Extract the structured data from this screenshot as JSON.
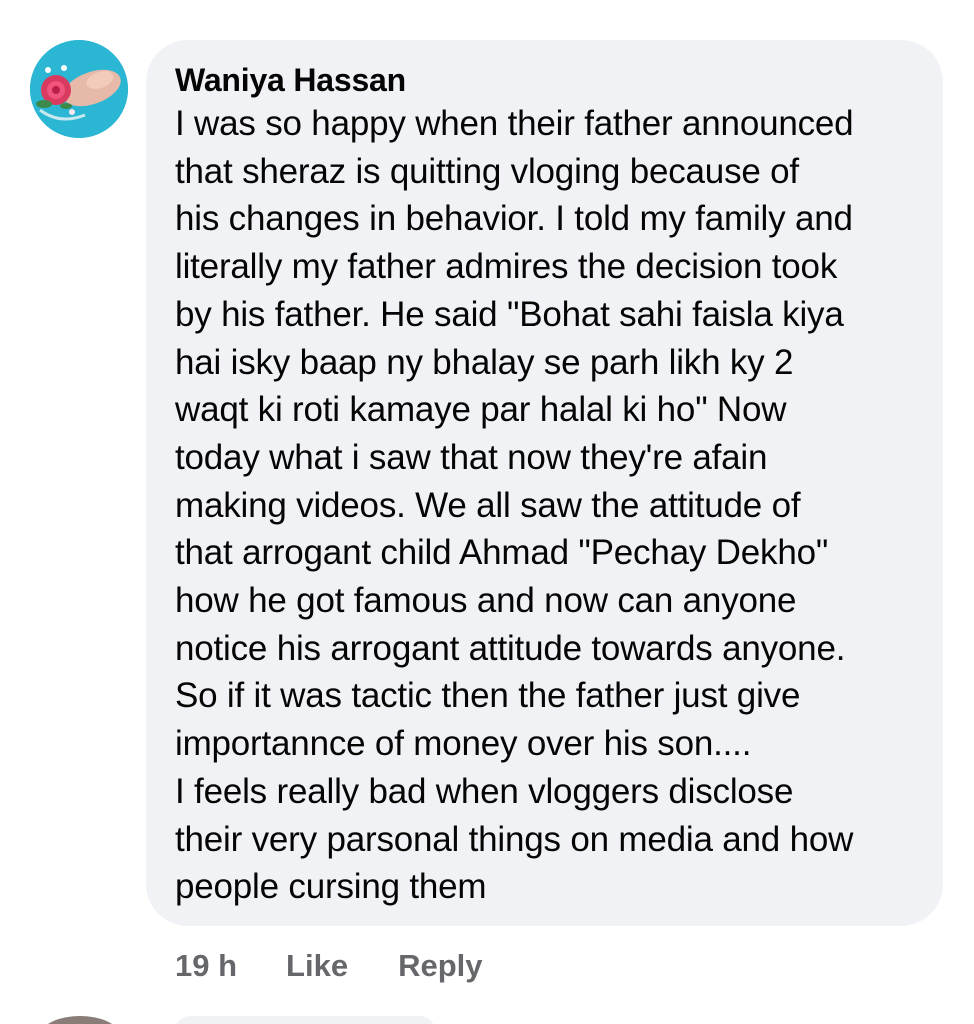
{
  "comment": {
    "author": "Waniya Hassan",
    "text": "I was so happy when their father announced\nthat sheraz is quitting vloging because of\nhis changes in behavior. I told my family and\nliterally my father admires the decision took\nby his father. He said \"Bohat sahi faisla kiya\nhai isky baap ny bhalay se parh likh ky 2\nwaqt ki roti kamaye par halal ki ho\" Now\ntoday what i saw that now they're afain\nmaking videos. We all saw the attitude of\nthat arrogant child Ahmad \"Pechay Dekho\"\nhow he got famous and now can anyone\nnotice his arrogant attitude towards anyone.\nSo if it was tactic then the father just give\nimportannce of money  over his son....\nI feels really bad when vloggers disclose\ntheir very parsonal things on media and how\npeople cursing them",
    "timestamp": "19 h",
    "like_label": "Like",
    "reply_label": "Reply"
  },
  "colors": {
    "bubble_bg": "#f0f2f5",
    "text": "#050505",
    "secondary_text": "#65676b",
    "avatar_bg": "#2bb6d3"
  },
  "icons": {
    "avatar": "profile-photo-rose-hand"
  }
}
